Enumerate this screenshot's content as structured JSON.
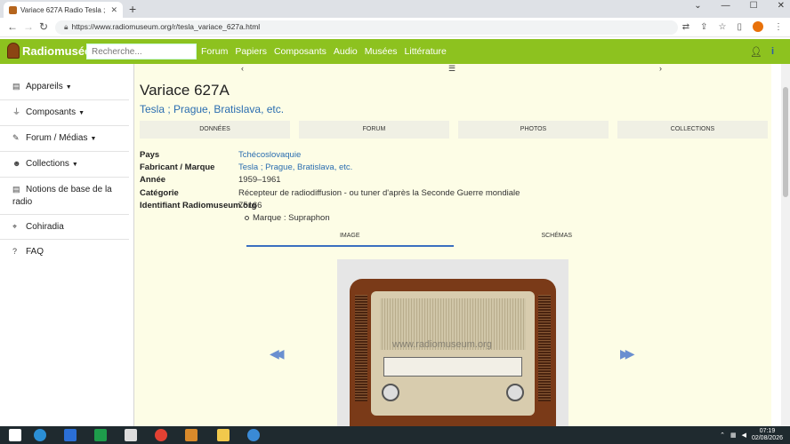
{
  "browser": {
    "tab_title": "Variace 627A Radio Tesla ; Praha",
    "url": "https://www.radiomuseum.org/r/tesla_variace_627a.html"
  },
  "site": {
    "logo_text": "Radiomusée",
    "search_placeholder": "Recherche...",
    "nav": [
      "Forum",
      "Papiers",
      "Composants",
      "Audio",
      "Musées",
      "Littérature"
    ]
  },
  "sidebar": {
    "items": [
      {
        "label": "Appareils",
        "icon": "radio-icon",
        "has_caret": true
      },
      {
        "label": "Composants",
        "icon": "plug-icon",
        "has_caret": true
      },
      {
        "label": "Forum / Médias",
        "icon": "chat-icon",
        "has_caret": true
      },
      {
        "label": "Collections",
        "icon": "users-icon",
        "has_caret": true
      },
      {
        "label": "Notions de base de la radio",
        "icon": "radio-icon",
        "has_caret": false
      },
      {
        "label": "Cohiradia",
        "icon": "antenna-icon",
        "has_caret": false
      },
      {
        "label": "FAQ",
        "icon": "question-icon",
        "has_caret": false
      }
    ]
  },
  "page": {
    "title": "Variace 627A",
    "maker": "Tesla ; Prague, Bratislava, etc.",
    "tabs": [
      "DONNÉES",
      "FORUM",
      "PHOTOS",
      "COLLECTIONS"
    ],
    "info": [
      {
        "key": "Pays",
        "value": "Tchécoslovaquie",
        "link": true
      },
      {
        "key": "Fabricant / Marque",
        "value": "Tesla ; Prague, Bratislava, etc.",
        "link": true
      },
      {
        "key": "Année",
        "value": "1959–1961",
        "link": false
      },
      {
        "key": "Catégorie",
        "value": "Récepteur de radiodiffusion - ou tuner d'après la Seconde Guerre mondiale",
        "link": false
      },
      {
        "key": "Identifiant Radiomuseum.org",
        "value": "75166",
        "link": false
      }
    ],
    "sub_item": "Marque : Supraphon",
    "image_tabs": [
      "IMAGE",
      "SCHÉMAS"
    ],
    "image_watermark": "www.radiomuseum.org"
  },
  "taskbar": {
    "time": "07:19",
    "date": "02/08/2026"
  },
  "colors": {
    "header_green": "#8dc21f",
    "content_bg": "#fdfde6",
    "link_blue": "#2a6db0",
    "active_tab_blue": "#3b6fc0"
  }
}
